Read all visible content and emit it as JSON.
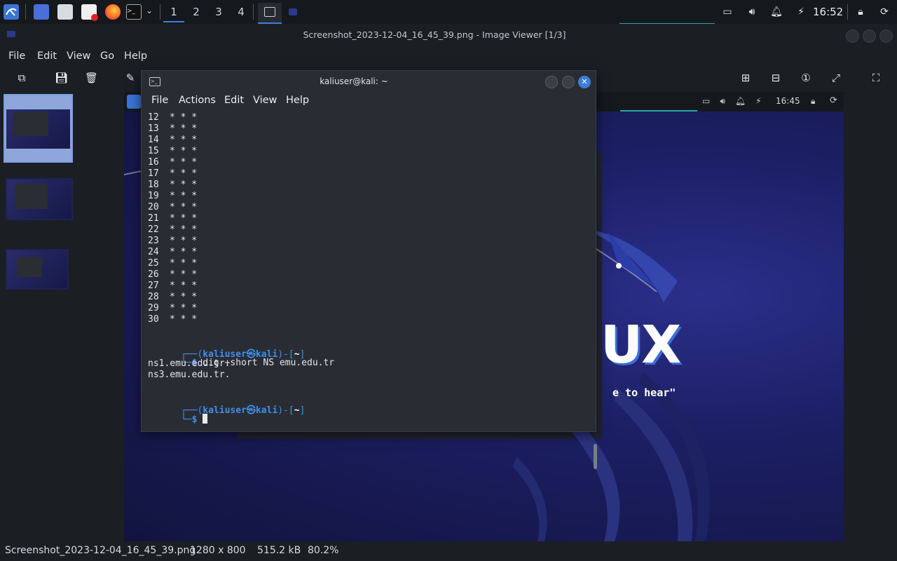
{
  "taskbar": {
    "workspaces": [
      "1",
      "2",
      "3",
      "4"
    ],
    "clock": "16:52"
  },
  "viewer": {
    "title": "Screenshot_2023-12-04_16_45_39.png - Image Viewer [1/3]",
    "menu": [
      "File",
      "Edit",
      "View",
      "Go",
      "Help"
    ]
  },
  "image": {
    "inner_clock": "16:45",
    "logo_text": "UX",
    "tagline": "e to hear\""
  },
  "terminal": {
    "title": "kaliuser@kali: ~",
    "menu": [
      "File",
      "Actions",
      "Edit",
      "View",
      "Help"
    ],
    "trace_rows": [
      "12",
      "13",
      "14",
      "15",
      "16",
      "17",
      "18",
      "19",
      "20",
      "21",
      "22",
      "23",
      "24",
      "25",
      "26",
      "27",
      "28",
      "29",
      "30"
    ],
    "trace_stars": "* * *",
    "prompt_open": "┌──(",
    "prompt_user": "kaliuser㉿kali",
    "prompt_close": ")-[",
    "prompt_dir": "~",
    "prompt_end": "]",
    "prompt_cmd_prefix": "└─",
    "prompt_dollar": "$",
    "command": "dig +short NS emu.edu.tr",
    "output": [
      "ns1.emu.edu.tr.",
      "ns3.emu.edu.tr."
    ]
  },
  "statusbar": {
    "filename": "Screenshot_2023-12-04_16_45_39.png",
    "dimensions": "1280 x 800",
    "filesize": "515.2 kB",
    "zoom": "80.2%"
  },
  "colors": {
    "accent": "#3f8fe8",
    "close_button": "#3b7ed8",
    "background": "#1b1e23"
  }
}
